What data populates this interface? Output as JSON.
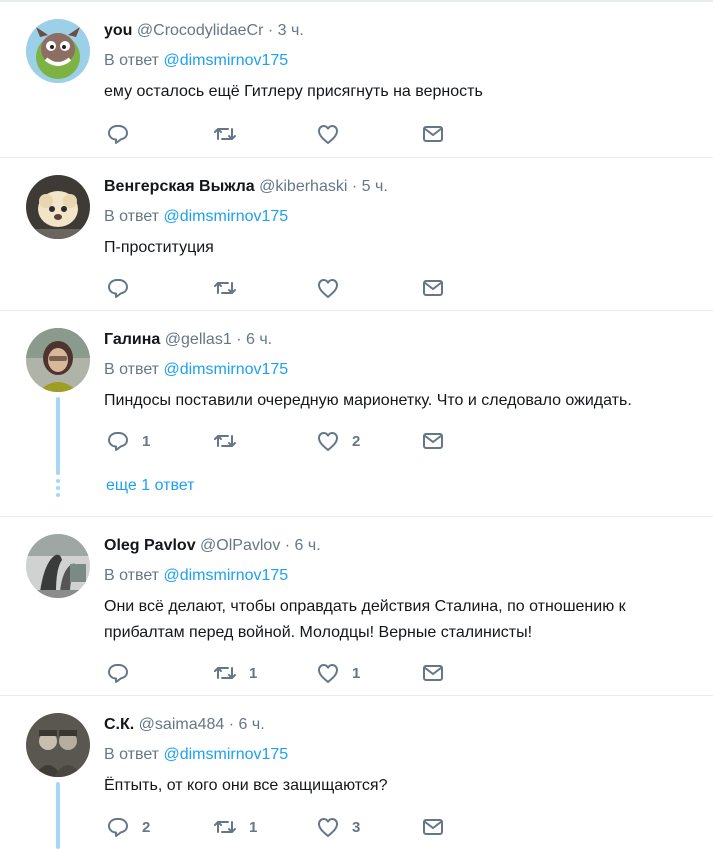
{
  "reply_prefix": "В ответ",
  "reply_target": "@dimsmirnov175",
  "tweets": [
    {
      "name": "you",
      "handle": "@CrocodylidaeCr",
      "dot": "·",
      "time": "3 ч.",
      "text": "ему осталось ещё Гитлеру присягнуть на верность",
      "reply_count": "",
      "retweet_count": "",
      "like_count": "",
      "avatar": "cartoon-mascot-avatar"
    },
    {
      "name": "Венгерская Выжла",
      "handle": "@kiberhaski",
      "dot": "·",
      "time": "5 ч.",
      "text": "П-проституция",
      "reply_count": "",
      "retweet_count": "",
      "like_count": "",
      "avatar": "plush-toy-avatar"
    },
    {
      "name": "Галина",
      "handle": "@gellas1",
      "dot": "·",
      "time": "6 ч.",
      "text": "Пиндосы поставили очередную марионетку. Что и следовало ожидать.",
      "reply_count": "1",
      "retweet_count": "",
      "like_count": "2",
      "more_replies": "еще 1 ответ",
      "avatar": "woman-portrait-avatar"
    },
    {
      "name": "Oleg Pavlov",
      "handle": "@OlPavlov",
      "dot": "·",
      "time": "6 ч.",
      "text": "Они всё делают, чтобы оправдать действия Сталина, по отношению к прибалтам перед войной. Молодцы! Верные сталинисты!",
      "reply_count": "",
      "retweet_count": "1",
      "like_count": "1",
      "avatar": "sculpture-avatar"
    },
    {
      "name": "С.К.",
      "handle": "@saima484",
      "dot": "·",
      "time": "6 ч.",
      "text": "Ёптыть, от кого они все защищаются?",
      "reply_count": "2",
      "retweet_count": "1",
      "like_count": "3",
      "avatar": "vintage-photo-avatar"
    }
  ],
  "colors": {
    "link": "#1da1f2",
    "muted": "#657786",
    "thread": "#a6d8f4",
    "divider": "#e6ecf0"
  }
}
